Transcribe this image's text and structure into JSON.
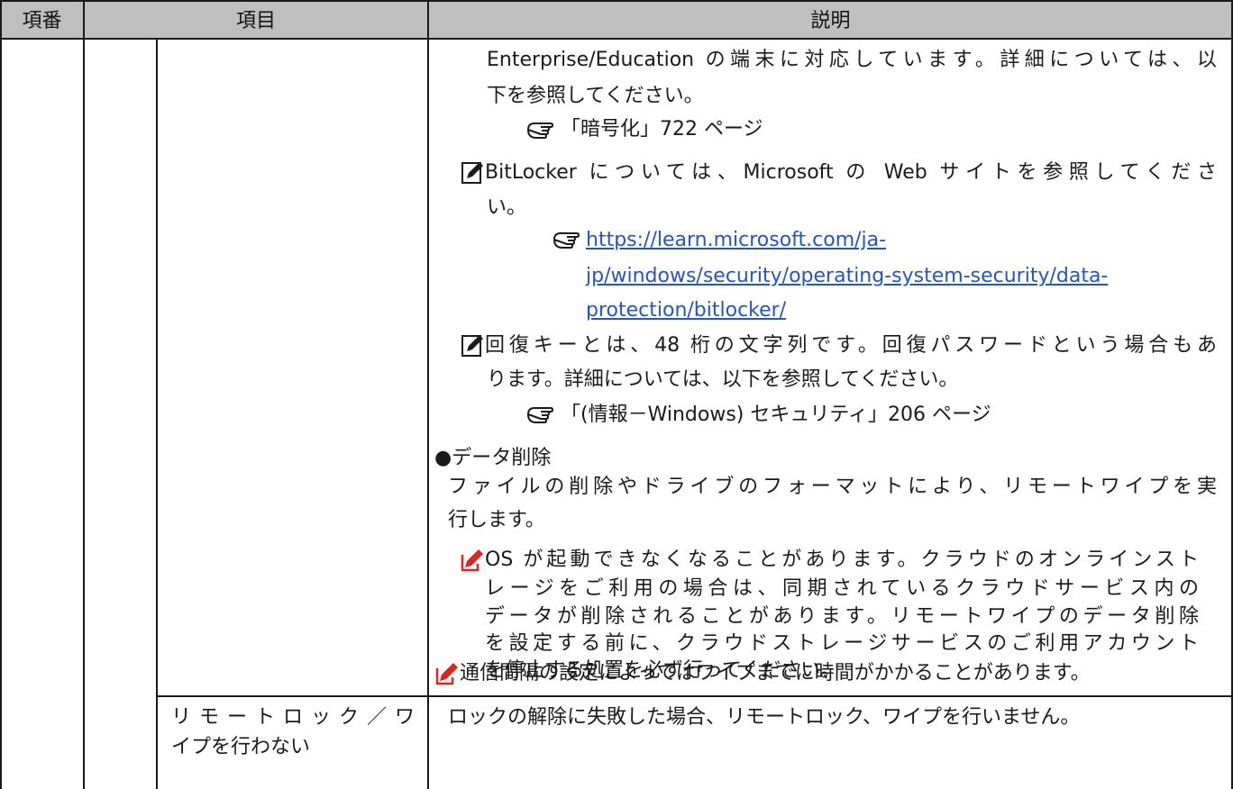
{
  "header": {
    "col_num": "項番",
    "col_item": "項目",
    "col_desc": "説明"
  },
  "desc": {
    "line1": "Enterprise/Education の端末に対応しています。詳細については、以",
    "line2": "下を参照してください。",
    "ref_encryption": "「暗号化」722 ページ",
    "note_bitlocker_l1": "BitLocker については、Microsoft の Web サイトを参照してくださ",
    "note_bitlocker_l2": "い。",
    "link_l1": "https://learn.microsoft.com/ja-",
    "link_l2": "jp/windows/security/operating-system-security/data-",
    "link_l3": "protection/bitlocker/",
    "note_recovery_l1": "回復キーとは、48 桁の文字列です。回復パスワードという場合もあ",
    "note_recovery_l2": "ります。詳細については、以下を参照してください。",
    "ref_security": "「(情報－Windows) セキュリティ」206 ページ",
    "bullet_title": "●データ削除",
    "delete_l1": "ファイルの削除やドライブのフォーマットにより、リモートワイプを実",
    "delete_l2": "行します。",
    "caution_l1": "OS が起動できなくなることがあります。クラウドのオンラインスト",
    "caution_l2": "レージをご利用の場合は、同期されているクラウドサービス内の",
    "caution_l3": "データが削除されることがあります。リモートワイプのデータ削除",
    "caution_l4": "を設定する前に、クラウドストレージサービスのご利用アカウント",
    "caution_l5": "を停止する処置を必ず行ってください。",
    "caution2": "通信間隔の設定によってはワイプまでに時間がかかることがあります。",
    "row2_desc": "ロックの解除に失敗した場合、リモートロック、ワイプを行いません。"
  },
  "row2": {
    "item_l1": "リモートロック／ワ",
    "item_l2": "イプを行わない"
  },
  "icons": {
    "pointing": "pointing-hand-icon",
    "memo": "memo-pencil-icon",
    "caution": "caution-pencil-icon",
    "caution_color": "#e0241b",
    "link_color": "#2454c9",
    "header_bg": "#bfbfbf"
  }
}
